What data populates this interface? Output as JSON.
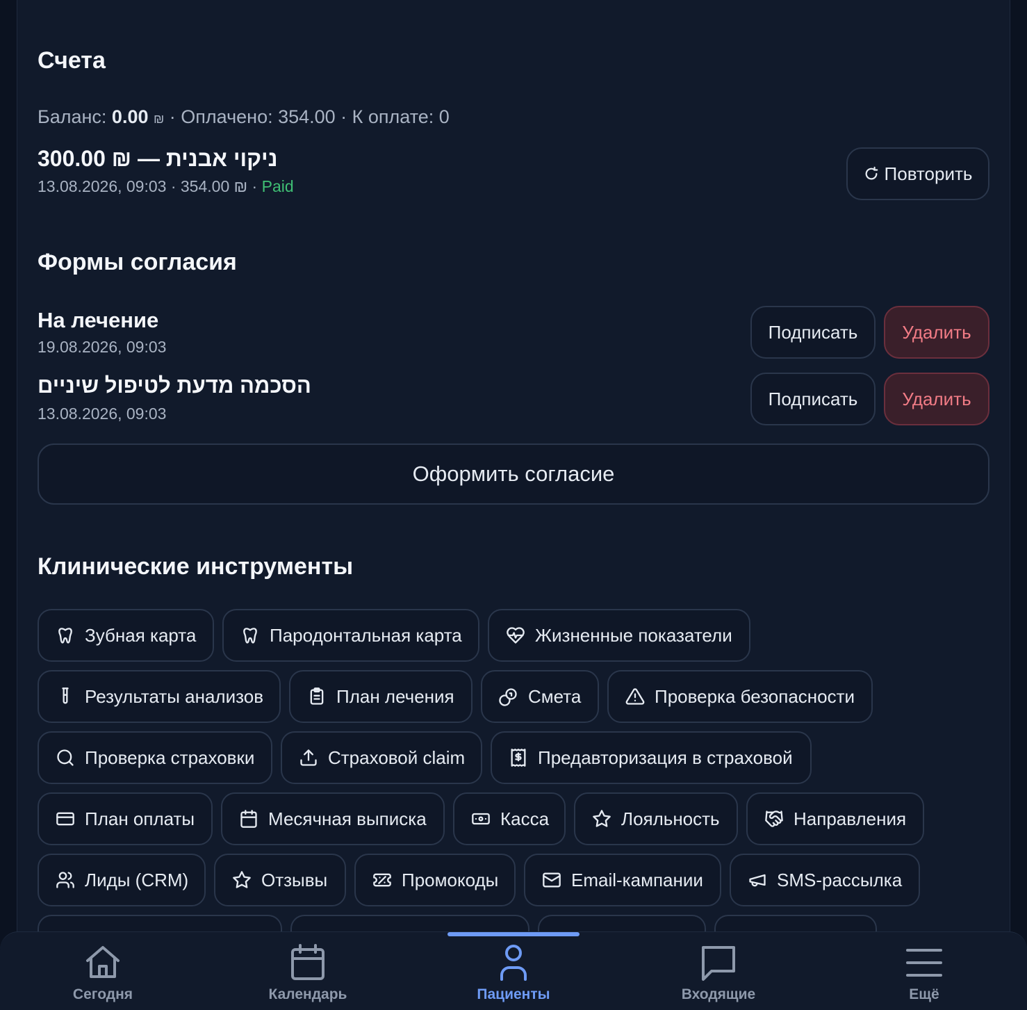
{
  "invoices": {
    "title": "Счета",
    "balance_label": "Баланс: ",
    "balance_value": "0.00",
    "currency": "₪",
    "paid_text": " · Оплачено: 354.00 · К оплате: 0",
    "item_title": "300.00 ₪ — ניקוי אבנית",
    "item_meta": "13.08.2026, 09:03 · 354.00 ₪ · ",
    "item_status": "Paid",
    "repeat_label": "Повторить",
    "status_color": "#3fbf74"
  },
  "consents": {
    "title": "Формы согласия",
    "items": [
      {
        "title": "На лечение",
        "date": "19.08.2026, 09:03",
        "sign_label": "Подписать",
        "delete_label": "Удалить"
      },
      {
        "title": "הסכמה מדעת לטיפול שיניים",
        "date": "13.08.2026, 09:03",
        "sign_label": "Подписать",
        "delete_label": "Удалить"
      }
    ],
    "create_label": "Оформить согласие"
  },
  "tools": {
    "title": "Клинические инструменты",
    "items": [
      {
        "label": "Зубная карта",
        "icon": "tooth-icon"
      },
      {
        "label": "Пародонтальная карта",
        "icon": "tooth-icon"
      },
      {
        "label": "Жизненные показатели",
        "icon": "heart-pulse-icon"
      },
      {
        "label": "Результаты анализов",
        "icon": "test-tube-icon"
      },
      {
        "label": "План лечения",
        "icon": "clipboard-icon"
      },
      {
        "label": "Смета",
        "icon": "coins-icon"
      },
      {
        "label": "Проверка безопасности",
        "icon": "warning-icon"
      },
      {
        "label": "Проверка страховки",
        "icon": "search-icon"
      },
      {
        "label": "Страховой claim",
        "icon": "upload-icon"
      },
      {
        "label": "Предавторизация в страховой",
        "icon": "receipt-icon"
      },
      {
        "label": "План оплаты",
        "icon": "credit-card-icon"
      },
      {
        "label": "Месячная выписка",
        "icon": "calendar-icon"
      },
      {
        "label": "Касса",
        "icon": "banknote-icon"
      },
      {
        "label": "Лояльность",
        "icon": "star-icon"
      },
      {
        "label": "Направления",
        "icon": "handshake-icon"
      },
      {
        "label": "Лиды (CRM)",
        "icon": "users-icon"
      },
      {
        "label": "Отзывы",
        "icon": "star-icon"
      },
      {
        "label": "Промокоды",
        "icon": "ticket-icon"
      },
      {
        "label": "Email-кампании",
        "icon": "mail-icon"
      },
      {
        "label": "SMS-рассылка",
        "icon": "megaphone-icon"
      }
    ]
  },
  "nav": {
    "items": [
      {
        "label": "Сегодня",
        "icon": "home-icon"
      },
      {
        "label": "Календарь",
        "icon": "calendar-icon"
      },
      {
        "label": "Пациенты",
        "icon": "user-icon",
        "active": true
      },
      {
        "label": "Входящие",
        "icon": "message-icon"
      },
      {
        "label": "Ещё",
        "icon": "menu-icon"
      }
    ],
    "active_color": "#6e9bf5"
  }
}
